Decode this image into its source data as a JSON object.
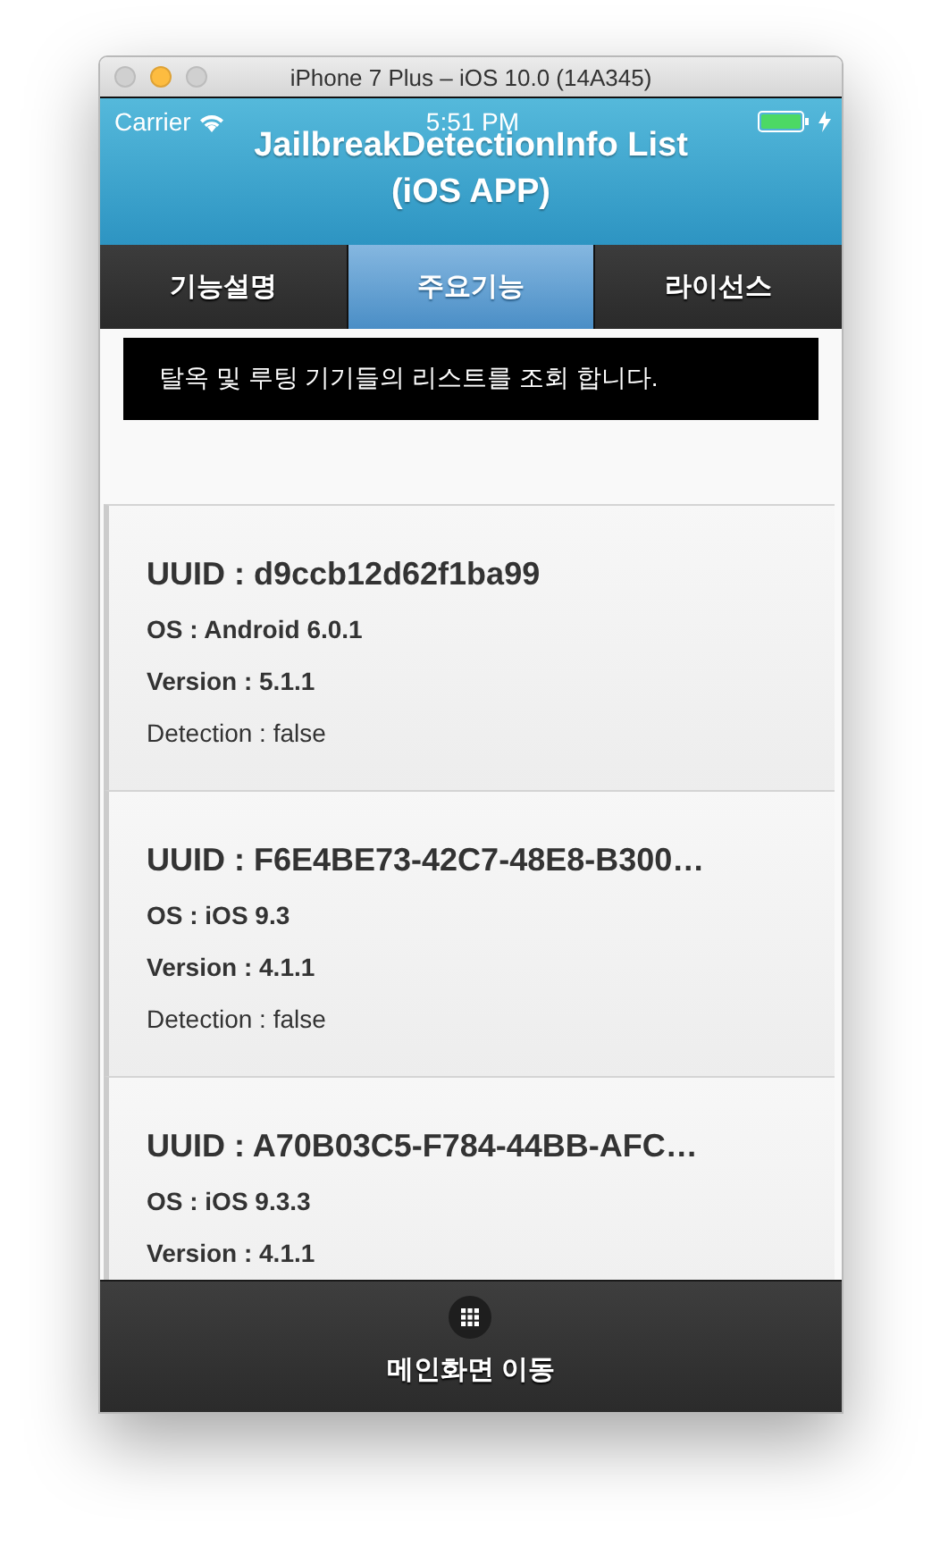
{
  "window": {
    "title": "iPhone 7 Plus – iOS 10.0 (14A345)"
  },
  "status_bar": {
    "carrier": "Carrier",
    "time": "5:51 PM"
  },
  "header": {
    "title_lines": [
      "JailbreakDetectionInfo List",
      "(iOS APP)"
    ]
  },
  "tabs": [
    {
      "label": "기능설명",
      "selected": false
    },
    {
      "label": "주요기능",
      "selected": true
    },
    {
      "label": "라이선스",
      "selected": false
    }
  ],
  "notice": "탈옥 및 루팅 기기들의 리스트를 조회 합니다.",
  "devices": [
    {
      "uuid": "UUID : d9ccb12d62f1ba99",
      "os": "OS : Android 6.0.1",
      "version": "Version : 5.1.1",
      "detection": "Detection : false"
    },
    {
      "uuid": "UUID : F6E4BE73-42C7-48E8-B300…",
      "os": "OS : iOS 9.3",
      "version": "Version : 4.1.1",
      "detection": "Detection : false"
    },
    {
      "uuid": "UUID : A70B03C5-F784-44BB-AFC…",
      "os": "OS : iOS 9.3.3",
      "version": "Version : 4.1.1"
    }
  ],
  "footer": {
    "label": "메인화면 이동"
  }
}
